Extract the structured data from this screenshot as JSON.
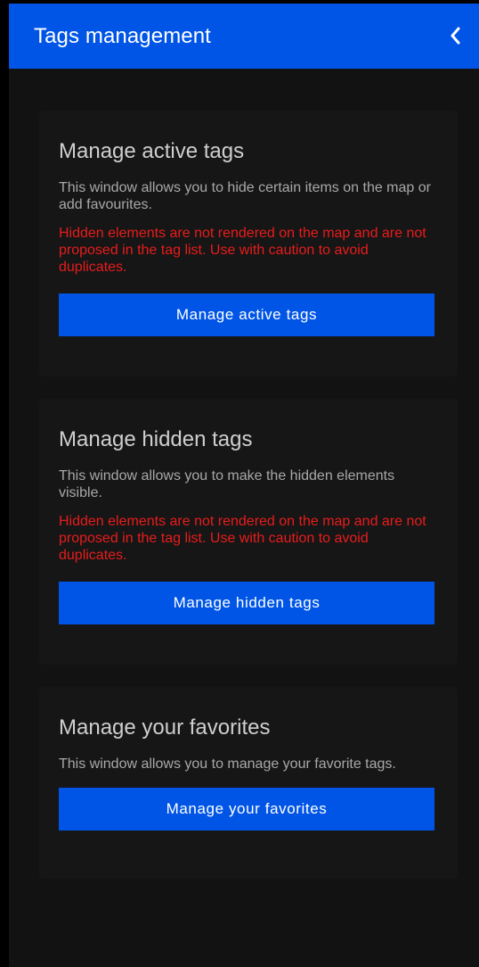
{
  "header": {
    "title": "Tags management",
    "back_icon": "chevron-left-icon",
    "background": "#0055e6"
  },
  "cards": [
    {
      "title": "Manage active tags",
      "description": "This window allows you to hide certain items on the map or add favourites.",
      "warning": "Hidden elements are not rendered on the map and are not proposed in the tag list. Use with caution to avoid duplicates.",
      "button_label": "Manage active tags"
    },
    {
      "title": "Manage hidden tags",
      "description": "This window allows you to make the hidden elements visible.",
      "warning": "Hidden elements are not rendered on the map and are not proposed in the tag list. Use with caution to avoid duplicates.",
      "button_label": "Manage hidden tags"
    },
    {
      "title": "Manage your favorites",
      "description": "This window allows you to manage your favorite tags.",
      "button_label": "Manage your favorites"
    }
  ],
  "colors": {
    "accent": "#0055e6",
    "warning": "#e81c1c",
    "background": "#121212"
  }
}
